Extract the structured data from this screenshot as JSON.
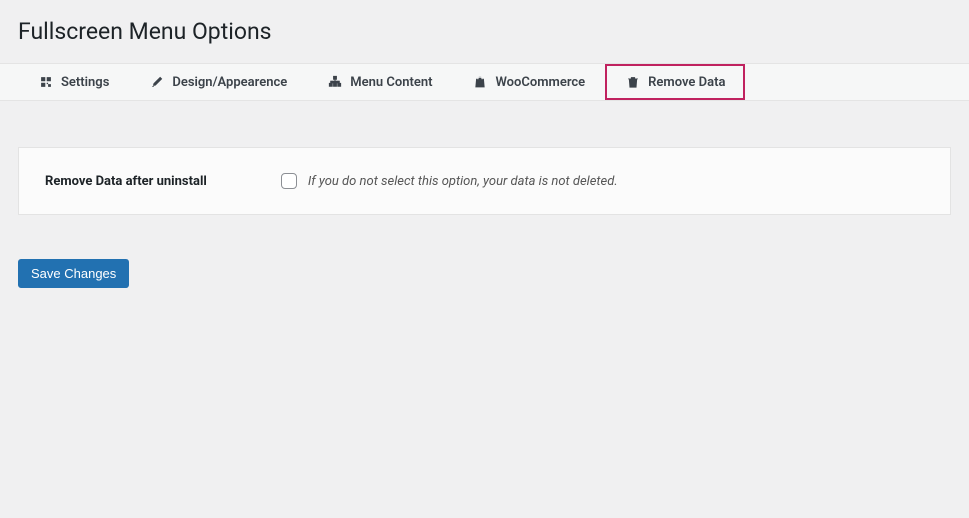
{
  "page": {
    "title": "Fullscreen Menu Options"
  },
  "tabs": [
    {
      "label": "Settings",
      "icon": "settings"
    },
    {
      "label": "Design/Appearence",
      "icon": "brush"
    },
    {
      "label": "Menu Content",
      "icon": "sitemap"
    },
    {
      "label": "WooCommerce",
      "icon": "bag"
    },
    {
      "label": "Remove Data",
      "icon": "trash",
      "active": true
    }
  ],
  "form": {
    "remove_data": {
      "label": "Remove Data after uninstall",
      "hint": "If you do not select this option, your data is not deleted.",
      "checked": false
    },
    "save_label": "Save Changes"
  }
}
